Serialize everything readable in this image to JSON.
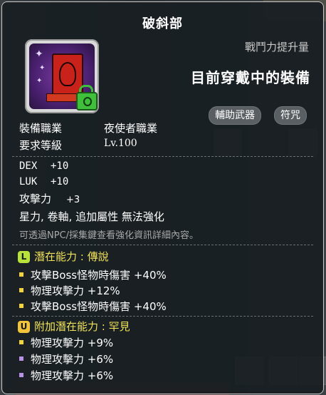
{
  "item": {
    "name": "破斜部",
    "power_label": "戰鬥力提升量",
    "equipped_label": "目前穿戴中的裝備",
    "tags": [
      "輔助武器",
      "符咒"
    ],
    "requirements": [
      {
        "label": "裝備職業",
        "value": "夜使者職業"
      },
      {
        "label": "要求等級",
        "value": "Lv.100"
      }
    ],
    "stats": [
      {
        "key": "DEX",
        "value": "+10"
      },
      {
        "key": "LUK",
        "value": "+10"
      },
      {
        "key": "攻擊力",
        "value": "+3"
      }
    ],
    "properties": "星力, 卷軸, 追加屬性 無法強化",
    "hint": "可透過NPC/採集鍵查看強化資訊詳細內容。"
  },
  "potential": {
    "badge": "L",
    "title": "潛在能力 : 傳說",
    "lines": [
      "攻擊Boss怪物時傷害 +40%",
      "物理攻擊力 +12%",
      "攻擊Boss怪物時傷害 +40%"
    ]
  },
  "bonus_potential": {
    "badge": "U",
    "title": "附加潛在能力 : 罕見",
    "lines": [
      "物理攻擊力 +9%",
      "物理攻擊力 +6%",
      "物理攻擊力 +6%"
    ]
  },
  "icons": {
    "item": "charm-emblem-icon",
    "lock": "lock-icon"
  },
  "colors": {
    "potential_title": "#f1e25a",
    "legend_badge": "#b6e23a",
    "unique_badge": "#f2c43a"
  }
}
